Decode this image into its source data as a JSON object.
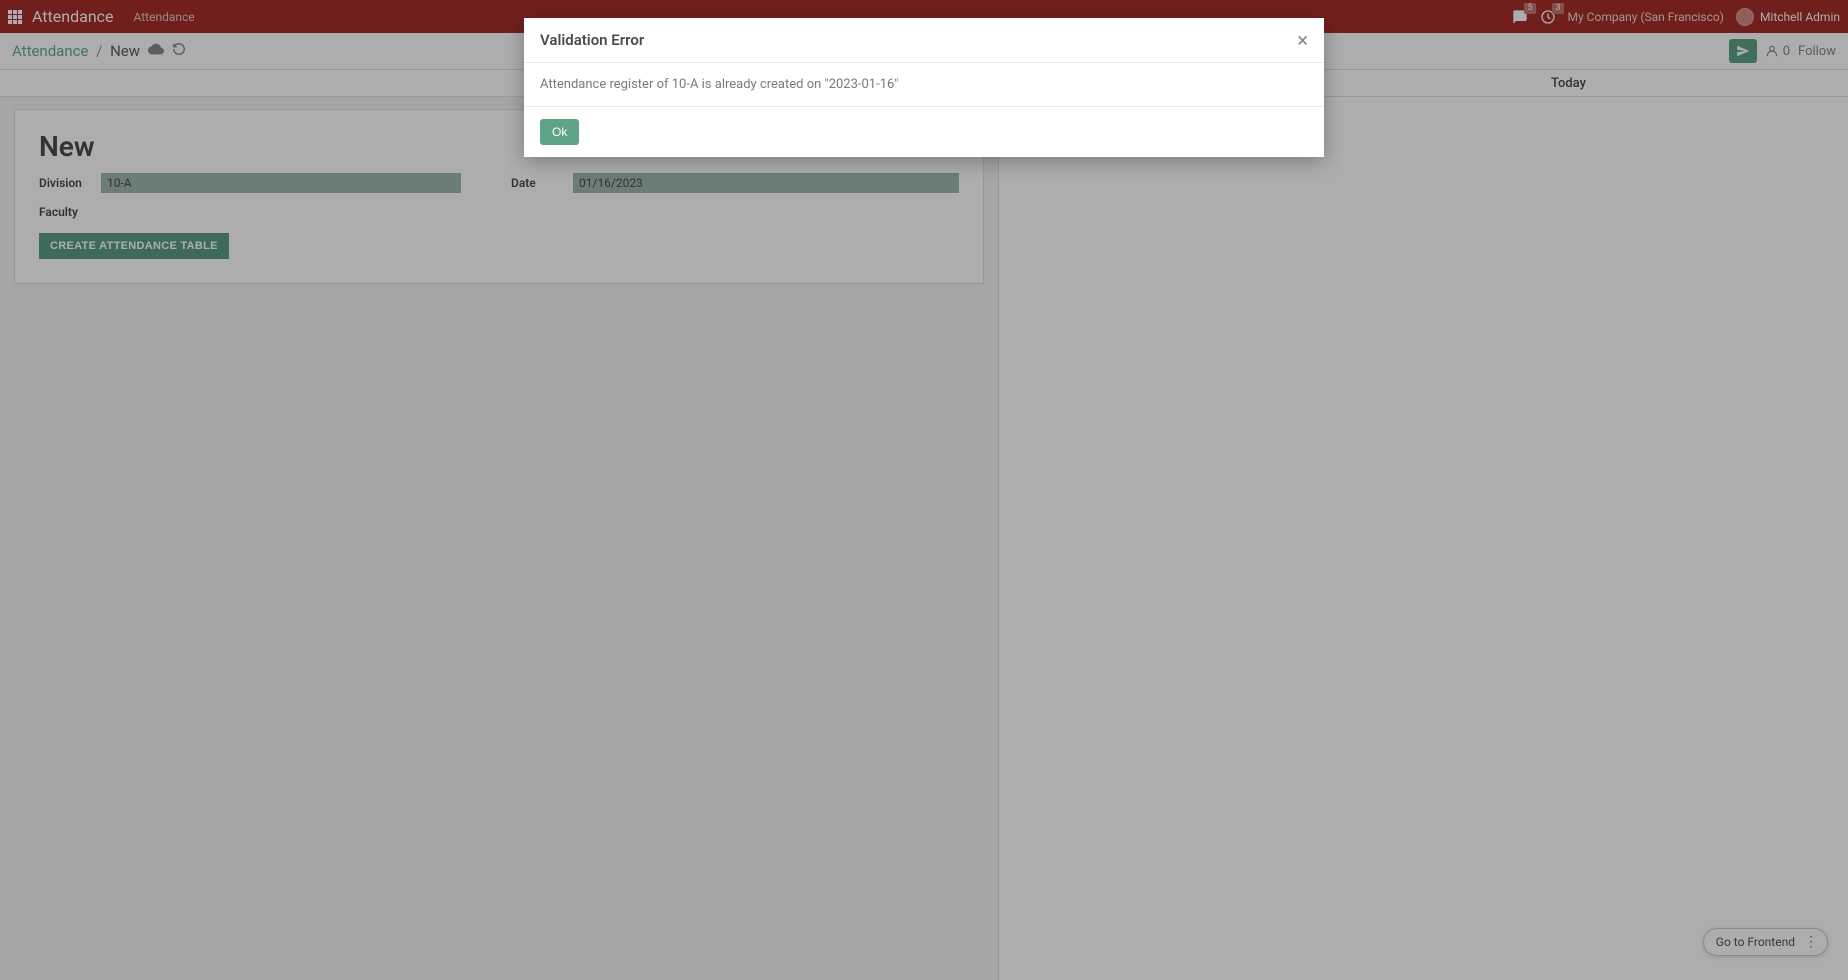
{
  "navbar": {
    "brand": "Attendance",
    "menu_item": "Attendance",
    "messages_badge": "5",
    "activities_badge": "3",
    "company": "My Company (San Francisco)",
    "user": "Mitchell Admin"
  },
  "breadcrumb": {
    "parent": "Attendance",
    "current": "New"
  },
  "control_panel": {
    "follower_count": "0",
    "follow_label": "Follow"
  },
  "status_row": {
    "today_label": "Today"
  },
  "form": {
    "title": "New",
    "division_label": "Division",
    "division_value": "10-A",
    "date_label": "Date",
    "date_value": "01/16/2023",
    "faculty_label": "Faculty",
    "create_button": "CREATE ATTENDANCE TABLE"
  },
  "modal": {
    "title": "Validation Error",
    "body": "Attendance register of 10-A is already created on \"2023-01-16\"",
    "ok": "Ok"
  },
  "footer": {
    "go_frontend": "Go to Frontend"
  }
}
